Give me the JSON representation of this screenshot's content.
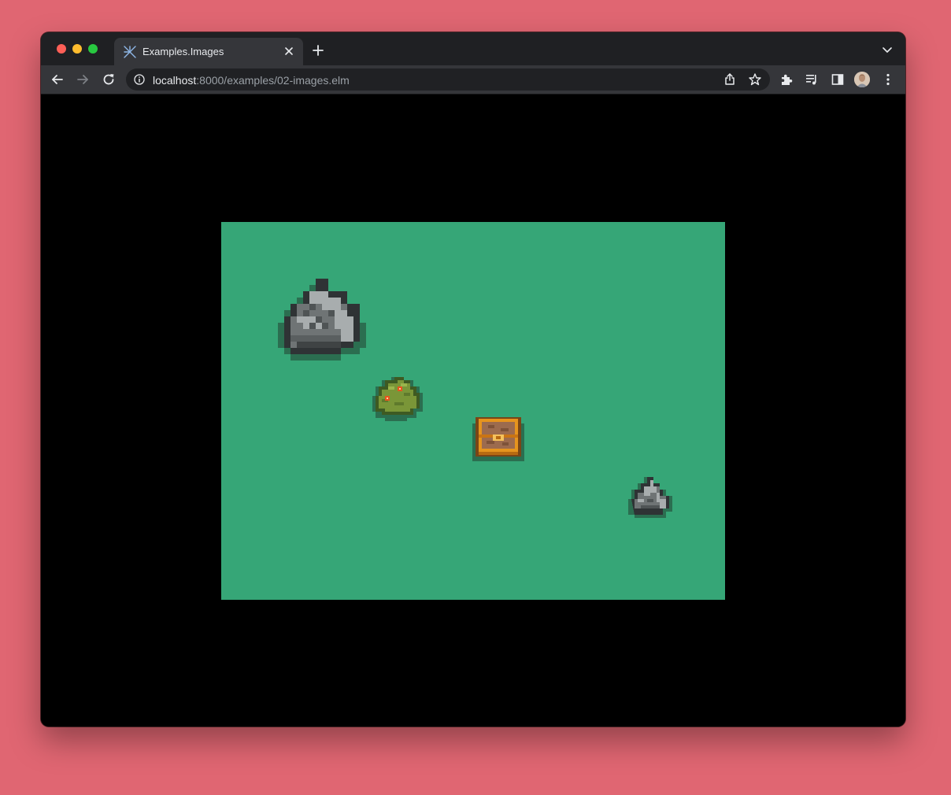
{
  "browser": {
    "tab": {
      "title": "Examples.Images"
    },
    "address_bar": {
      "host": "localhost",
      "path": ":8000/examples/02-images.elm"
    }
  },
  "game": {
    "background_color": "#36a677",
    "sprites": [
      "large-rock",
      "berry-bush",
      "treasure-chest",
      "small-rock"
    ]
  },
  "colors": {
    "page_background": "#e06672",
    "tab_bar": "#1f2023",
    "toolbar": "#35363a",
    "omnibox": "#202124"
  }
}
